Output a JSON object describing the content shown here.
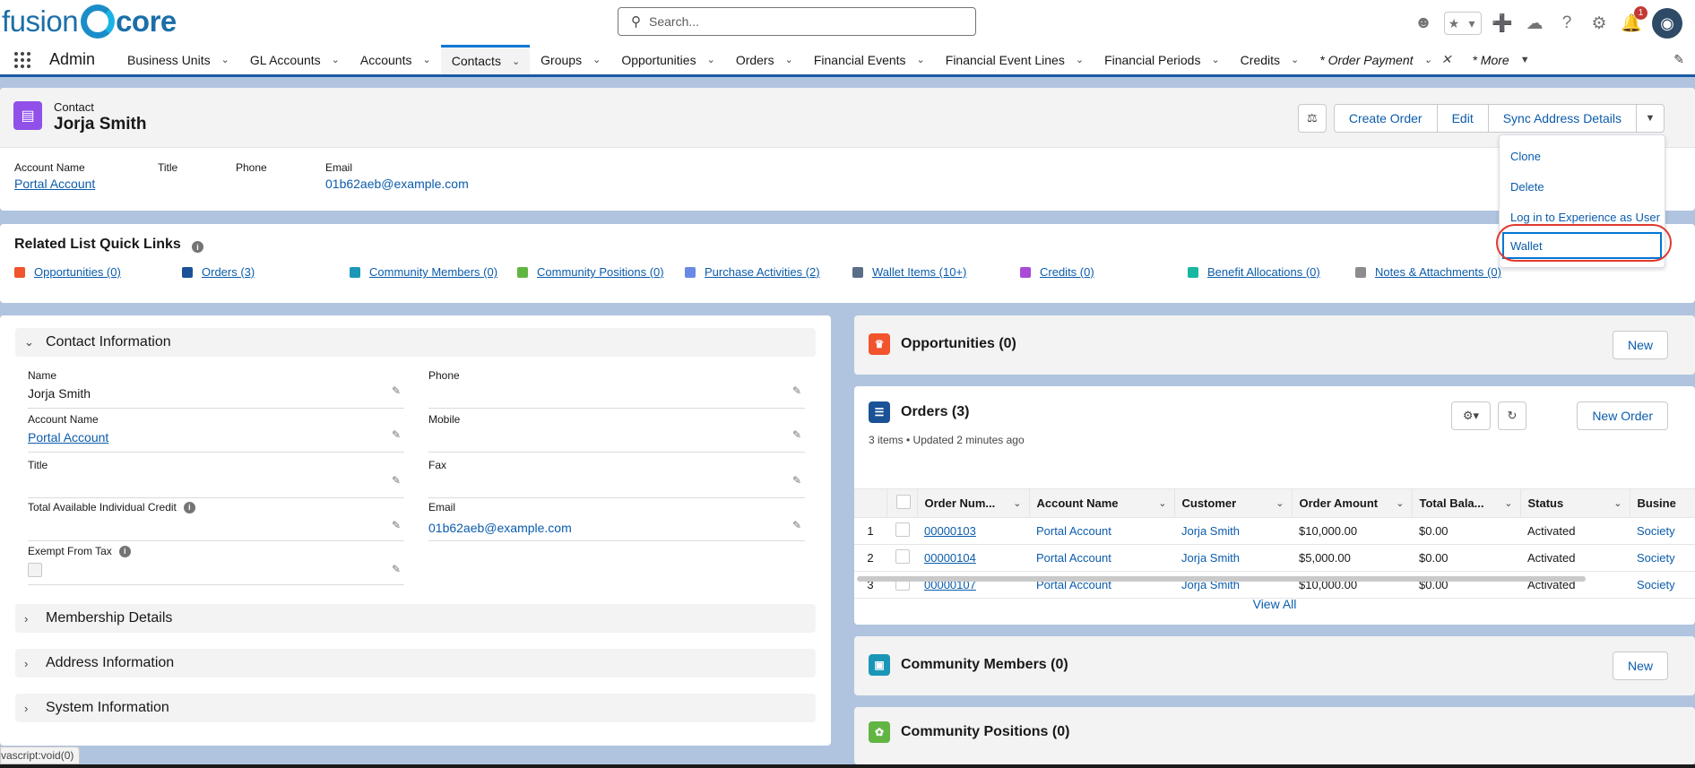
{
  "brand": {
    "logo_left": "fusion",
    "logo_right": "core"
  },
  "search": {
    "placeholder": "Search..."
  },
  "header_icons": [
    "astro-icon",
    "favorites-star-icon",
    "favorites-dropdown-icon",
    "global-actions-add-icon",
    "trailhead-icon",
    "help-icon",
    "setup-gear-icon",
    "notifications-bell-icon",
    "user-avatar"
  ],
  "notifications": {
    "count": "1"
  },
  "app": {
    "name": "Admin"
  },
  "nav": {
    "tabs": [
      {
        "label": "Business Units"
      },
      {
        "label": "GL Accounts"
      },
      {
        "label": "Accounts"
      },
      {
        "label": "Contacts"
      },
      {
        "label": "Groups"
      },
      {
        "label": "Opportunities"
      },
      {
        "label": "Orders"
      },
      {
        "label": "Financial Events"
      },
      {
        "label": "Financial Event Lines"
      },
      {
        "label": "Financial Periods"
      },
      {
        "label": "Credits"
      },
      {
        "label": "* Order Payment"
      },
      {
        "label": "* More"
      }
    ],
    "active": "Contacts"
  },
  "record": {
    "type": "Contact",
    "name": "Jorja Smith",
    "actions": {
      "create_order": "Create Order",
      "edit": "Edit",
      "sync": "Sync Address Details"
    },
    "highlights": {
      "account_name_label": "Account Name",
      "account_name": "Portal Account",
      "title_label": "Title",
      "phone_label": "Phone",
      "email_label": "Email",
      "email": "01b62aeb@example.com"
    }
  },
  "menu": {
    "items": [
      "Clone",
      "Delete",
      "Log in to Experience as User",
      "Wallet"
    ]
  },
  "quicklinks": {
    "title": "Related List Quick Links",
    "links": [
      {
        "label": "Opportunities (0)",
        "color": "#f2542d"
      },
      {
        "label": "Orders (3)",
        "color": "#1b5297"
      },
      {
        "label": "Community Members (0)",
        "color": "#1b96b7"
      },
      {
        "label": "Community Positions (0)",
        "color": "#62b543"
      },
      {
        "label": "Purchase Activities (2)",
        "color": "#6a89e5"
      },
      {
        "label": "Wallet Items (10+)",
        "color": "#5b6e88"
      },
      {
        "label": "Credits (0)",
        "color": "#a94ad9"
      },
      {
        "label": "Benefit Allocations (0)",
        "color": "#18b7a1"
      },
      {
        "label": "Notes & Attachments (0)",
        "color": "#8c8c8c"
      }
    ]
  },
  "detail": {
    "sections": {
      "contact": "Contact Information",
      "membership": "Membership Details",
      "address": "Address Information",
      "system": "System Information"
    },
    "fields": {
      "name_label": "Name",
      "name": "Jorja Smith",
      "phone_label": "Phone",
      "phone": "",
      "account_label": "Account Name",
      "account": "Portal Account",
      "mobile_label": "Mobile",
      "mobile": "",
      "title_label": "Title",
      "title": "",
      "fax_label": "Fax",
      "fax": "",
      "credit_label": "Total Available Individual Credit",
      "credit": "",
      "email_label": "Email",
      "email": "01b62aeb@example.com",
      "exempt_label": "Exempt From Tax"
    }
  },
  "related": {
    "opportunities": {
      "title": "Opportunities (0)",
      "new": "New"
    },
    "orders": {
      "title": "Orders (3)",
      "meta": "3 items • Updated 2 minutes ago",
      "new": "New Order",
      "columns": [
        "Order Num...",
        "Account Name",
        "Customer",
        "Order Amount",
        "Total Bala...",
        "Status",
        "Busine"
      ],
      "rows": [
        {
          "n": "1",
          "order": "00000103",
          "account": "Portal Account",
          "customer": "Jorja Smith",
          "amount": "$10,000.00",
          "balance": "$0.00",
          "status": "Activated",
          "business": "Society"
        },
        {
          "n": "2",
          "order": "00000104",
          "account": "Portal Account",
          "customer": "Jorja Smith",
          "amount": "$5,000.00",
          "balance": "$0.00",
          "status": "Activated",
          "business": "Society"
        },
        {
          "n": "3",
          "order": "00000107",
          "account": "Portal Account",
          "customer": "Jorja Smith",
          "amount": "$10,000.00",
          "balance": "$0.00",
          "status": "Activated",
          "business": "Society"
        }
      ],
      "view_all": "View All"
    },
    "community_members": {
      "title": "Community Members (0)",
      "new": "New"
    },
    "community_positions": {
      "title": "Community Positions (0)"
    }
  },
  "status_bar": {
    "text": "vascript:void(0)"
  }
}
